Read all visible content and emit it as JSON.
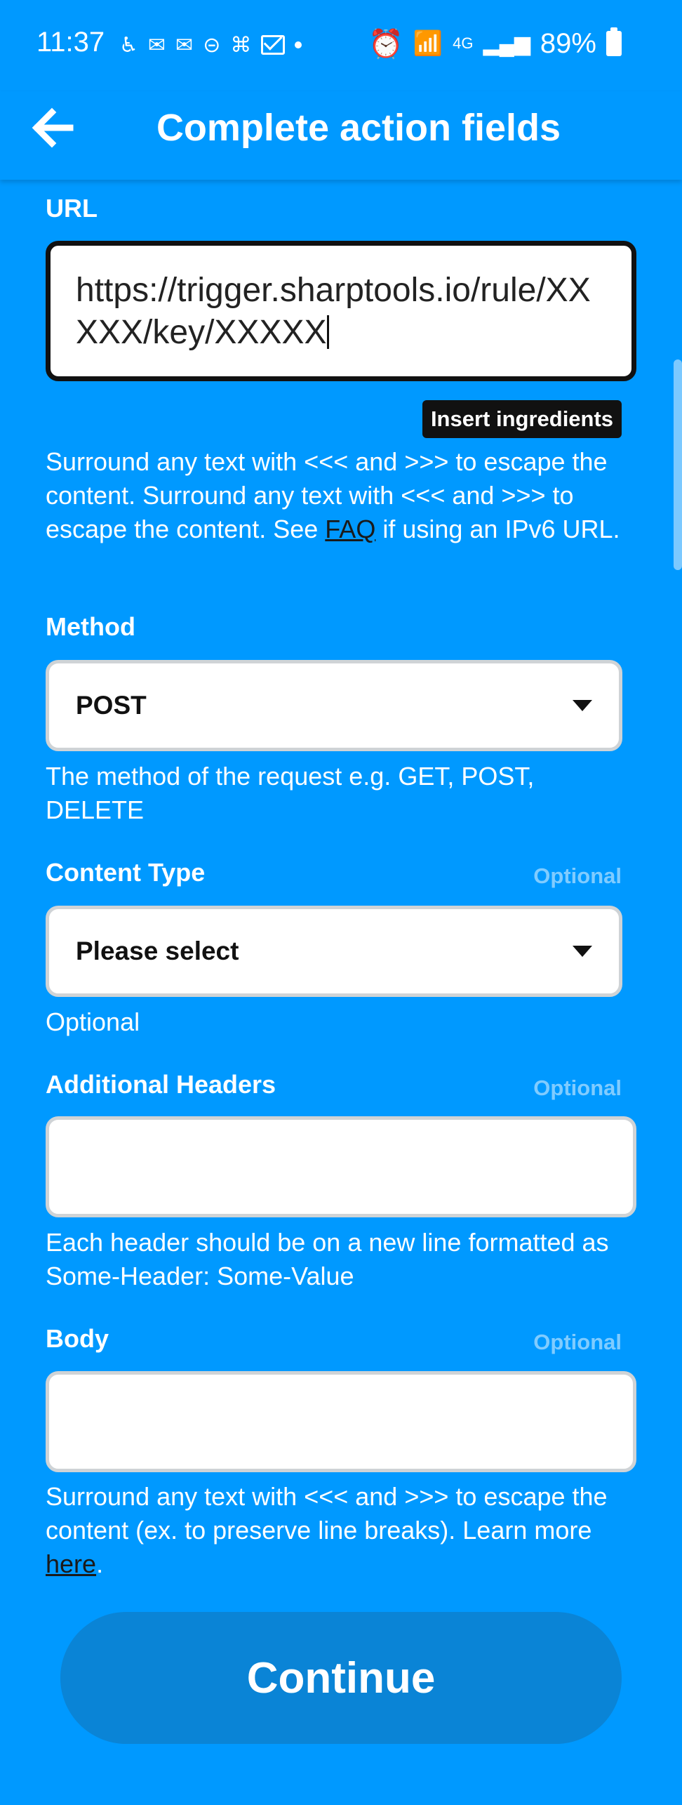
{
  "status": {
    "time": "11:37",
    "network": "4G",
    "battery": "89%"
  },
  "header": {
    "title": "Complete action fields"
  },
  "url_field": {
    "label": "URL",
    "value": "https://trigger.sharptools.io/rule/XXXXX/key/XXXXX",
    "insert_label": "Insert ingredients",
    "help_text": "Surround any text with <<< and >>> to escape the content. Surround any text with <<< and >>> to escape the content. See ",
    "help_link": "FAQ",
    "help_suffix": " if using an IPv6 URL."
  },
  "method": {
    "label": "Method",
    "value": "POST",
    "help": "The method of the request e.g. GET, POST, DELETE"
  },
  "content_type": {
    "label": "Content Type",
    "optional": "Optional",
    "value": "Please select",
    "help": "Optional"
  },
  "headers": {
    "label": "Additional Headers",
    "optional": "Optional",
    "value": "",
    "help": "Each header should be on a new line formatted as Some-Header: Some-Value"
  },
  "body_field": {
    "label": "Body",
    "optional": "Optional",
    "value": "",
    "help_text": "Surround any text with <<< and >>> to escape the content (ex. to preserve line breaks). Learn more ",
    "help_link": "here",
    "help_suffix": "."
  },
  "continue_label": "Continue",
  "colors": {
    "background": "#0099ff",
    "button": "#0a84d6",
    "optional": "#80ccff"
  }
}
